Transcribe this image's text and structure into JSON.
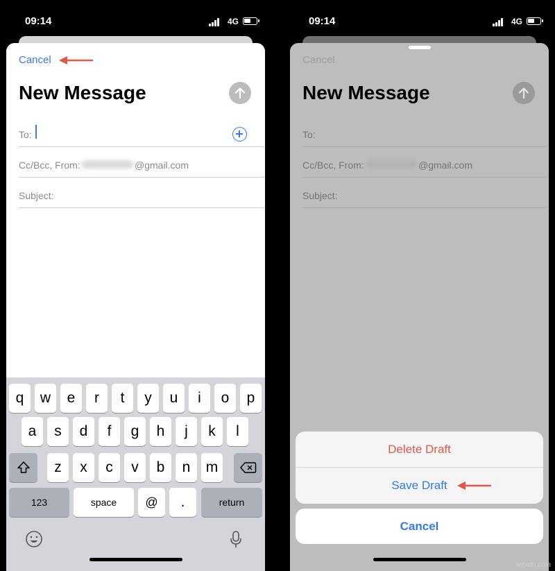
{
  "colors": {
    "ios_blue": "#3478f6",
    "ios_red": "#e4554a",
    "annotation_arrow": "#e4554a"
  },
  "left_screen": {
    "status_bar": {
      "time": "09:14",
      "network": "4G"
    },
    "compose": {
      "cancel_label": "Cancel",
      "title": "New Message",
      "send_icon": "arrow-up-circle-icon",
      "to_label": "To:",
      "cc_label": "Cc/Bcc, From:",
      "email_suffix": "@gmail.com",
      "subject_label": "Subject:"
    },
    "keyboard": {
      "row1": [
        "q",
        "w",
        "e",
        "r",
        "t",
        "y",
        "u",
        "i",
        "o",
        "p"
      ],
      "row2": [
        "a",
        "s",
        "d",
        "f",
        "g",
        "h",
        "j",
        "k",
        "l"
      ],
      "row3": [
        "z",
        "x",
        "c",
        "v",
        "b",
        "n",
        "m"
      ],
      "numbers_key": "123",
      "space_key": "space",
      "at_key": "@",
      "period_key": ".",
      "return_key": "return"
    }
  },
  "right_screen": {
    "status_bar": {
      "time": "09:14",
      "network": "4G"
    },
    "compose": {
      "cancel_label": "Cancel",
      "title": "New Message",
      "to_label": "To:",
      "cc_label": "Cc/Bcc, From:",
      "email_suffix": "@gmail.com",
      "subject_label": "Subject:"
    },
    "action_sheet": {
      "delete_label": "Delete Draft",
      "save_label": "Save Draft",
      "cancel_label": "Cancel"
    }
  },
  "watermark": "wsxdn.com"
}
